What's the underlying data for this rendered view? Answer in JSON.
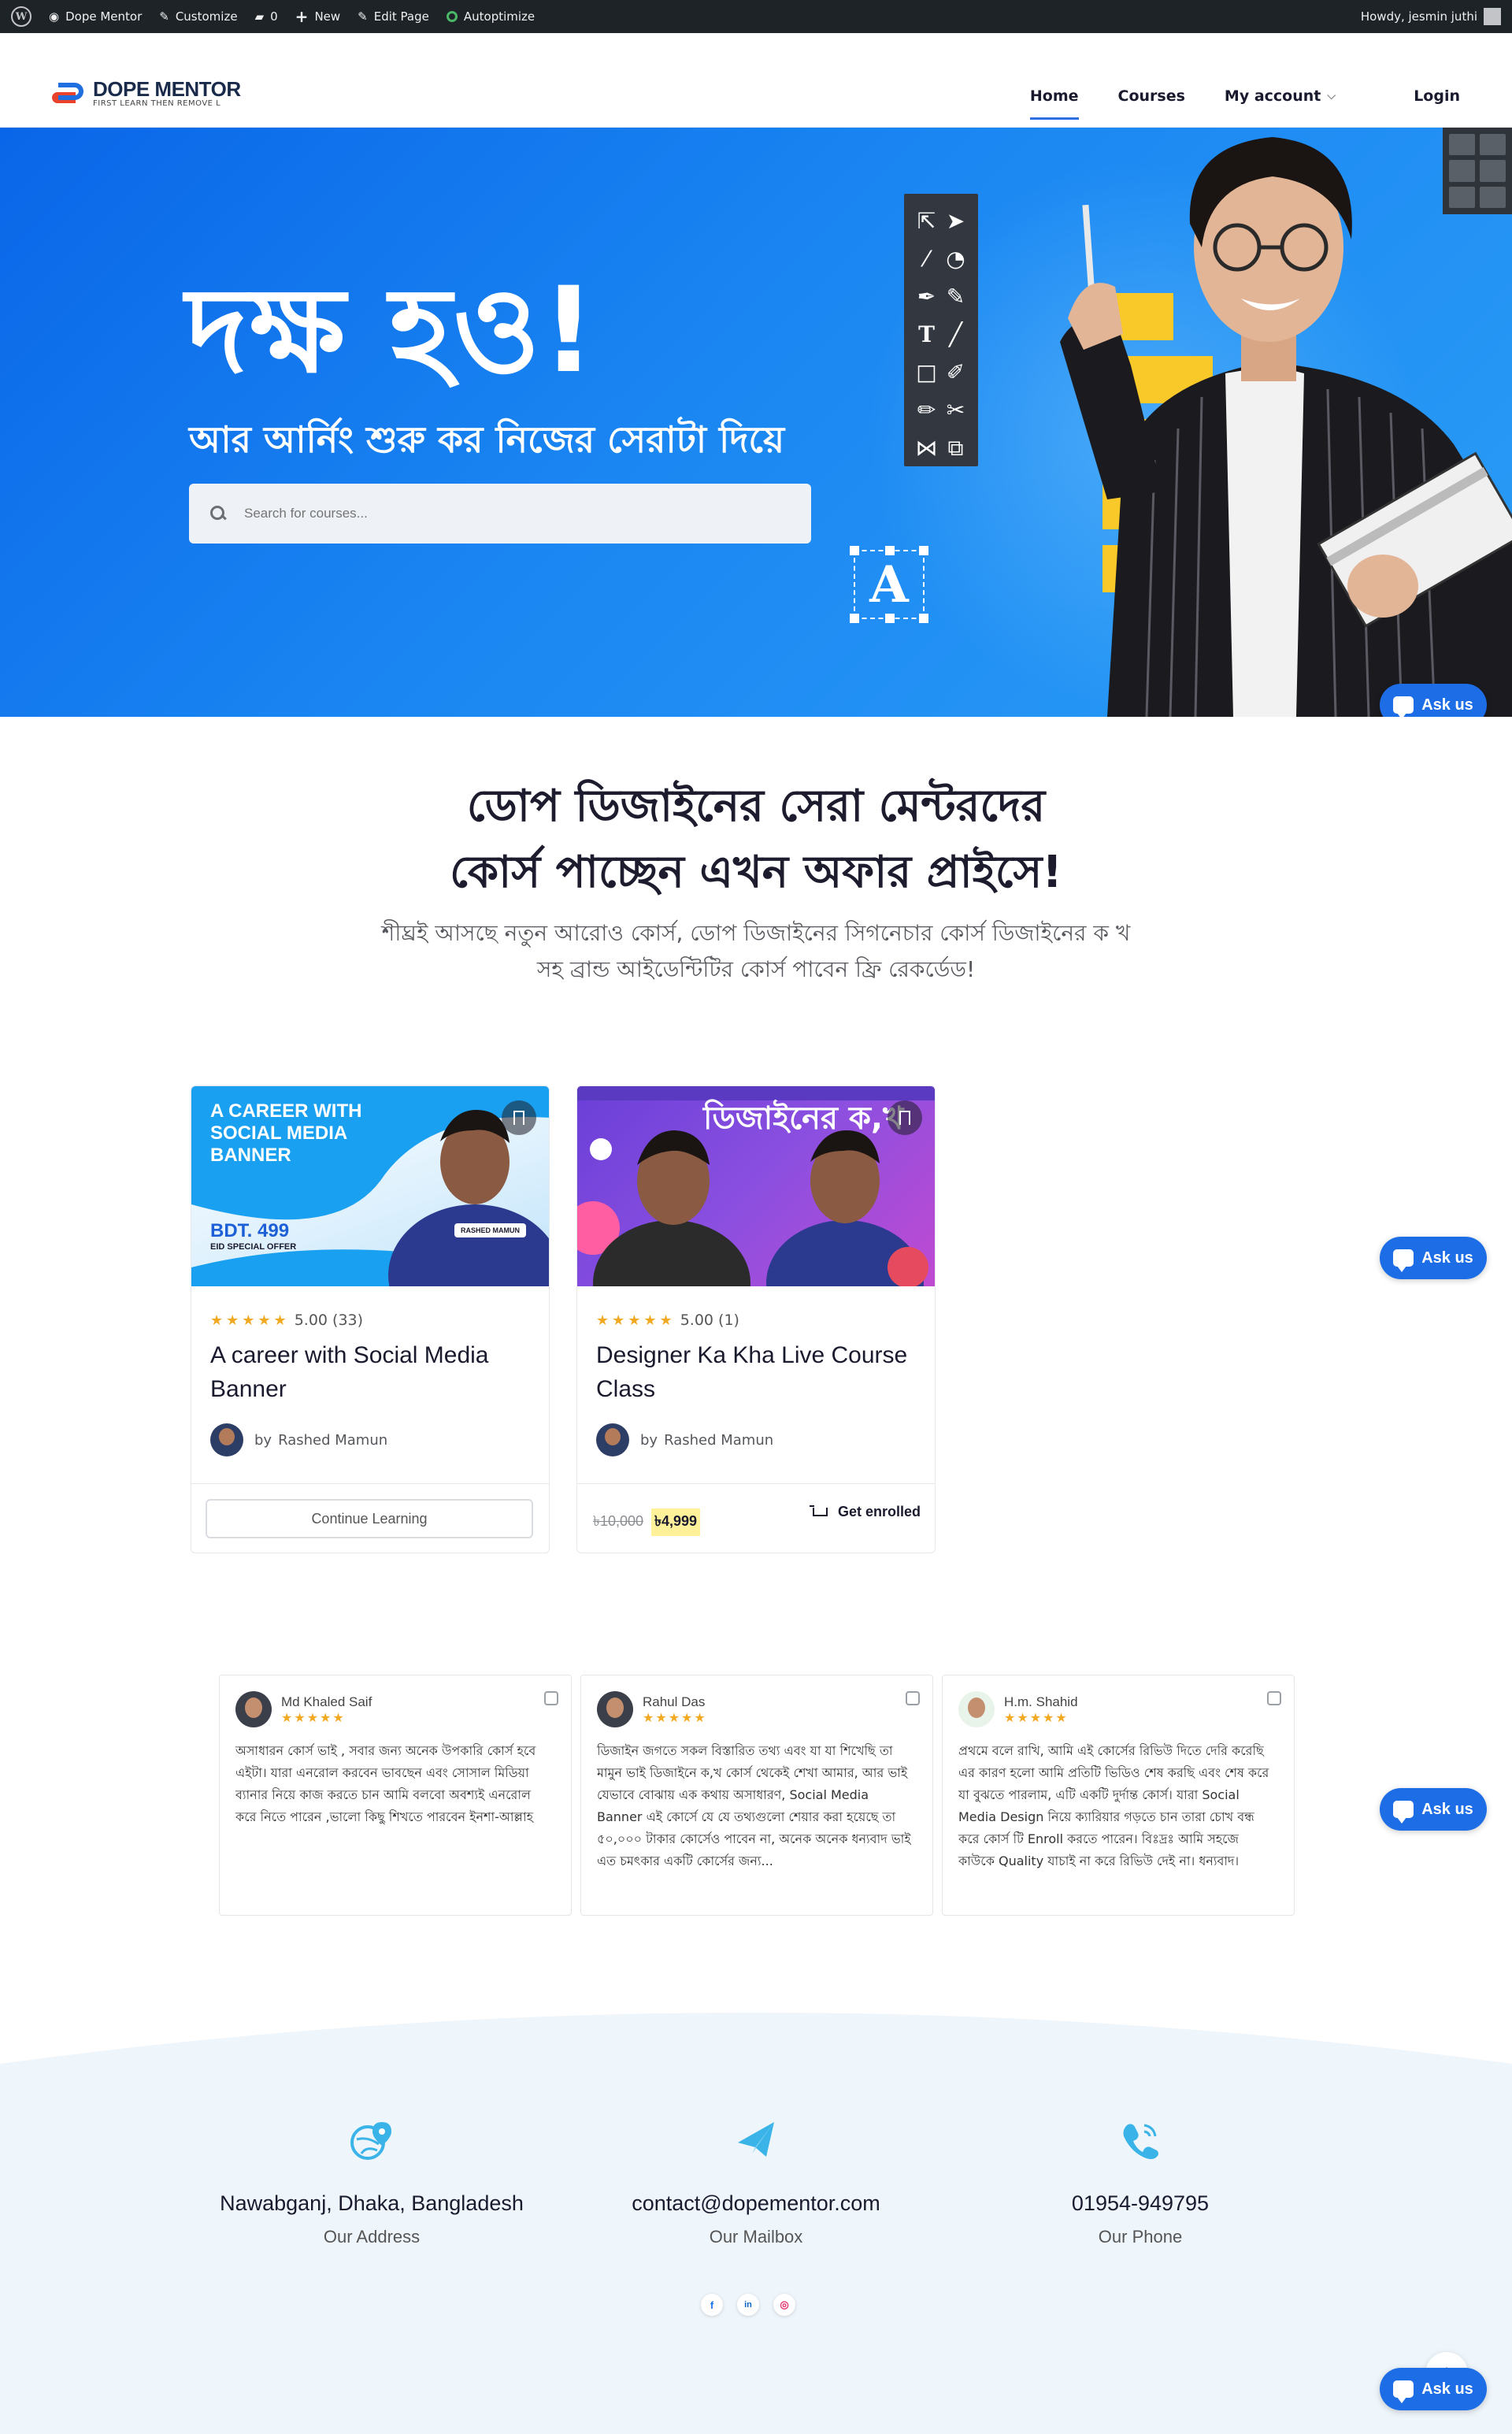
{
  "adminbar": {
    "site": "Dope Mentor",
    "customize": "Customize",
    "comments": "0",
    "new": "New",
    "edit": "Edit Page",
    "autoptimize": "Autoptimize",
    "howdy": "Howdy, jesmin juthi"
  },
  "header": {
    "logo_title": "DOPE MENTOR",
    "logo_tagline": "FIRST LEARN THEN REMOVE L",
    "nav": [
      "Home",
      "Courses",
      "My account"
    ],
    "login": "Login"
  },
  "hero": {
    "title": "দক্ষ হও!",
    "subtitle": "আর আর্নিং শুরু কর নিজের সেরাটা দিয়ে",
    "search_placeholder": "Search for courses...",
    "toolbar_icons": [
      "cursor-arrow",
      "cursor-solid",
      "magic-wand",
      "lasso",
      "pen",
      "pen-add",
      "text",
      "line",
      "rectangle",
      "edit",
      "pencil",
      "scissors",
      "flip",
      "crop"
    ],
    "a_letter": "A"
  },
  "ask_label": "Ask us",
  "intro": {
    "heading_line1": "ডোপ ডিজাইনের সেরা মেন্টরদের",
    "heading_line2": "কোর্স পাচ্ছেন এখন অফার প্রাইসে!",
    "lead_line1": "শীঘ্রই আসছে নতুন আরোও কোর্স, ডোপ ডিজাইনের সিগনেচার কোর্স ডিজাইনের ক খ",
    "lead_line2": "সহ ব্রান্ড আইডেন্টিটির কোর্স পাবেন ফ্রি রেকর্ডেড!"
  },
  "courses": [
    {
      "rating": "5.00 (33)",
      "title": "A career with Social Media Banner",
      "author": "Rashed Mamun",
      "by": "by",
      "action": "Continue Learning",
      "thumb_title": "A CAREER WITH SOCIAL MEDIA BANNER",
      "thumb_price": "BDT. 499",
      "thumb_offer": "EID SPECIAL OFFER",
      "thumb_name": "RASHED MAMUN"
    },
    {
      "rating": "5.00 (1)",
      "title": "Designer Ka Kha Live Course Class",
      "author": "Rashed Mamun",
      "by": "by",
      "price_old": "৳10,000",
      "price_new": "৳4,999",
      "action": "Get enrolled",
      "thumb_title": "ডিজাইনের ক,খ"
    }
  ],
  "reviews": [
    {
      "name": "Md Khaled Saif",
      "stars": "★★★★★",
      "text": "অসাধারন কোর্স ভাই , সবার জন্য অনেক উপকারি কোর্স হবে এইটা। যারা এনরোল করবেন ভাবছেন এবং সোসাল মিডিয়া ব্যানার নিয়ে কাজ করতে চান আমি বলবো অবশ্যই এনরোল করে নিতে পারেন ,ভালো কিছু শিখতে পারবেন ইনশা-আল্লাহ"
    },
    {
      "name": "Rahul Das",
      "stars": "★★★★★",
      "text": "ডিজাইন জগতে সকল বিস্তারিত তথ্য এবং যা যা শিখেছি তা মামুন ভাই ডিজাইনে ক,খ কোর্স থেকেই শেখা আমার, আর ভাই যেভাবে বোঝায় এক কথায় অসাধারণ, Social Media Banner এই কোর্সে যে যে তথ্যগুলো শেয়ার করা হয়েছে তা ৫০,০০০ টাকার কোর্সেও পাবেন না, অনেক অনেক ধন্যবাদ ভাই এত চমৎকার একটি কোর্সের জন্য..."
    },
    {
      "name": "H.m. Shahid",
      "stars": "★★★★★",
      "text": "প্রথমে বলে রাখি, আমি এই কোর্সের রিভিউ দিতে দেরি করেছি এর কারণ হলো আমি প্রতিটি ভিডিও শেষ করছি এবং শেষ করে যা বুঝতে পারলাম, এটি একটি দুর্দান্ত কোর্স। যারা Social Media Design নিয়ে ক্যারিয়ার গড়তে চান তারা চোখ বন্ধ করে কোর্স টি Enroll করতে পারেন। বিঃদ্রঃ আমি সহজে কাউকে Quality যাচাই না করে রিভিউ দেই না। ধন্যবাদ।"
    }
  ],
  "footer": {
    "address": "Nawabganj, Dhaka, Bangladesh",
    "address_label": "Our Address",
    "mail": "contact@dopementor.com",
    "mail_label": "Our Mailbox",
    "phone": "01954-949795",
    "phone_label": "Our Phone",
    "social": [
      "f",
      "in",
      "ig"
    ]
  },
  "colors": {
    "accent": "#1d6ee6",
    "hero_start": "#0a66e8",
    "hero_end": "#2b9df6",
    "star": "#f2a922",
    "footer_bg": "#eef5fb",
    "contact_icon": "#3ab4e8"
  }
}
